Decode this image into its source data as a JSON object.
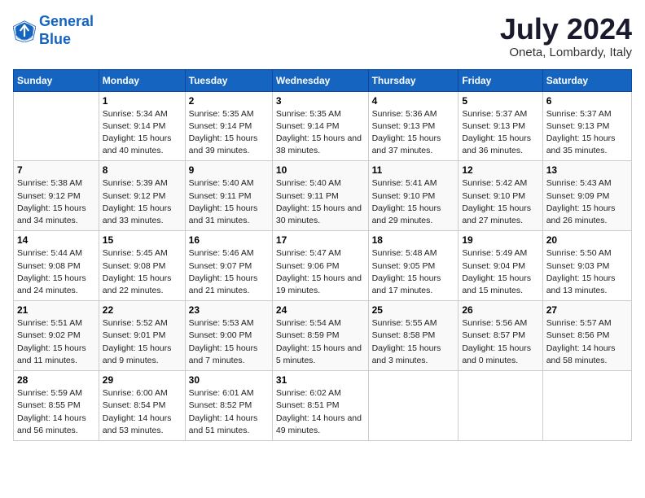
{
  "header": {
    "logo_line1": "General",
    "logo_line2": "Blue",
    "month_title": "July 2024",
    "location": "Oneta, Lombardy, Italy"
  },
  "weekdays": [
    "Sunday",
    "Monday",
    "Tuesday",
    "Wednesday",
    "Thursday",
    "Friday",
    "Saturday"
  ],
  "weeks": [
    [
      {
        "day": "",
        "sunrise": "",
        "sunset": "",
        "daylight": ""
      },
      {
        "day": "1",
        "sunrise": "Sunrise: 5:34 AM",
        "sunset": "Sunset: 9:14 PM",
        "daylight": "Daylight: 15 hours and 40 minutes."
      },
      {
        "day": "2",
        "sunrise": "Sunrise: 5:35 AM",
        "sunset": "Sunset: 9:14 PM",
        "daylight": "Daylight: 15 hours and 39 minutes."
      },
      {
        "day": "3",
        "sunrise": "Sunrise: 5:35 AM",
        "sunset": "Sunset: 9:14 PM",
        "daylight": "Daylight: 15 hours and 38 minutes."
      },
      {
        "day": "4",
        "sunrise": "Sunrise: 5:36 AM",
        "sunset": "Sunset: 9:13 PM",
        "daylight": "Daylight: 15 hours and 37 minutes."
      },
      {
        "day": "5",
        "sunrise": "Sunrise: 5:37 AM",
        "sunset": "Sunset: 9:13 PM",
        "daylight": "Daylight: 15 hours and 36 minutes."
      },
      {
        "day": "6",
        "sunrise": "Sunrise: 5:37 AM",
        "sunset": "Sunset: 9:13 PM",
        "daylight": "Daylight: 15 hours and 35 minutes."
      }
    ],
    [
      {
        "day": "7",
        "sunrise": "Sunrise: 5:38 AM",
        "sunset": "Sunset: 9:12 PM",
        "daylight": "Daylight: 15 hours and 34 minutes."
      },
      {
        "day": "8",
        "sunrise": "Sunrise: 5:39 AM",
        "sunset": "Sunset: 9:12 PM",
        "daylight": "Daylight: 15 hours and 33 minutes."
      },
      {
        "day": "9",
        "sunrise": "Sunrise: 5:40 AM",
        "sunset": "Sunset: 9:11 PM",
        "daylight": "Daylight: 15 hours and 31 minutes."
      },
      {
        "day": "10",
        "sunrise": "Sunrise: 5:40 AM",
        "sunset": "Sunset: 9:11 PM",
        "daylight": "Daylight: 15 hours and 30 minutes."
      },
      {
        "day": "11",
        "sunrise": "Sunrise: 5:41 AM",
        "sunset": "Sunset: 9:10 PM",
        "daylight": "Daylight: 15 hours and 29 minutes."
      },
      {
        "day": "12",
        "sunrise": "Sunrise: 5:42 AM",
        "sunset": "Sunset: 9:10 PM",
        "daylight": "Daylight: 15 hours and 27 minutes."
      },
      {
        "day": "13",
        "sunrise": "Sunrise: 5:43 AM",
        "sunset": "Sunset: 9:09 PM",
        "daylight": "Daylight: 15 hours and 26 minutes."
      }
    ],
    [
      {
        "day": "14",
        "sunrise": "Sunrise: 5:44 AM",
        "sunset": "Sunset: 9:08 PM",
        "daylight": "Daylight: 15 hours and 24 minutes."
      },
      {
        "day": "15",
        "sunrise": "Sunrise: 5:45 AM",
        "sunset": "Sunset: 9:08 PM",
        "daylight": "Daylight: 15 hours and 22 minutes."
      },
      {
        "day": "16",
        "sunrise": "Sunrise: 5:46 AM",
        "sunset": "Sunset: 9:07 PM",
        "daylight": "Daylight: 15 hours and 21 minutes."
      },
      {
        "day": "17",
        "sunrise": "Sunrise: 5:47 AM",
        "sunset": "Sunset: 9:06 PM",
        "daylight": "Daylight: 15 hours and 19 minutes."
      },
      {
        "day": "18",
        "sunrise": "Sunrise: 5:48 AM",
        "sunset": "Sunset: 9:05 PM",
        "daylight": "Daylight: 15 hours and 17 minutes."
      },
      {
        "day": "19",
        "sunrise": "Sunrise: 5:49 AM",
        "sunset": "Sunset: 9:04 PM",
        "daylight": "Daylight: 15 hours and 15 minutes."
      },
      {
        "day": "20",
        "sunrise": "Sunrise: 5:50 AM",
        "sunset": "Sunset: 9:03 PM",
        "daylight": "Daylight: 15 hours and 13 minutes."
      }
    ],
    [
      {
        "day": "21",
        "sunrise": "Sunrise: 5:51 AM",
        "sunset": "Sunset: 9:02 PM",
        "daylight": "Daylight: 15 hours and 11 minutes."
      },
      {
        "day": "22",
        "sunrise": "Sunrise: 5:52 AM",
        "sunset": "Sunset: 9:01 PM",
        "daylight": "Daylight: 15 hours and 9 minutes."
      },
      {
        "day": "23",
        "sunrise": "Sunrise: 5:53 AM",
        "sunset": "Sunset: 9:00 PM",
        "daylight": "Daylight: 15 hours and 7 minutes."
      },
      {
        "day": "24",
        "sunrise": "Sunrise: 5:54 AM",
        "sunset": "Sunset: 8:59 PM",
        "daylight": "Daylight: 15 hours and 5 minutes."
      },
      {
        "day": "25",
        "sunrise": "Sunrise: 5:55 AM",
        "sunset": "Sunset: 8:58 PM",
        "daylight": "Daylight: 15 hours and 3 minutes."
      },
      {
        "day": "26",
        "sunrise": "Sunrise: 5:56 AM",
        "sunset": "Sunset: 8:57 PM",
        "daylight": "Daylight: 15 hours and 0 minutes."
      },
      {
        "day": "27",
        "sunrise": "Sunrise: 5:57 AM",
        "sunset": "Sunset: 8:56 PM",
        "daylight": "Daylight: 14 hours and 58 minutes."
      }
    ],
    [
      {
        "day": "28",
        "sunrise": "Sunrise: 5:59 AM",
        "sunset": "Sunset: 8:55 PM",
        "daylight": "Daylight: 14 hours and 56 minutes."
      },
      {
        "day": "29",
        "sunrise": "Sunrise: 6:00 AM",
        "sunset": "Sunset: 8:54 PM",
        "daylight": "Daylight: 14 hours and 53 minutes."
      },
      {
        "day": "30",
        "sunrise": "Sunrise: 6:01 AM",
        "sunset": "Sunset: 8:52 PM",
        "daylight": "Daylight: 14 hours and 51 minutes."
      },
      {
        "day": "31",
        "sunrise": "Sunrise: 6:02 AM",
        "sunset": "Sunset: 8:51 PM",
        "daylight": "Daylight: 14 hours and 49 minutes."
      },
      {
        "day": "",
        "sunrise": "",
        "sunset": "",
        "daylight": ""
      },
      {
        "day": "",
        "sunrise": "",
        "sunset": "",
        "daylight": ""
      },
      {
        "day": "",
        "sunrise": "",
        "sunset": "",
        "daylight": ""
      }
    ]
  ]
}
